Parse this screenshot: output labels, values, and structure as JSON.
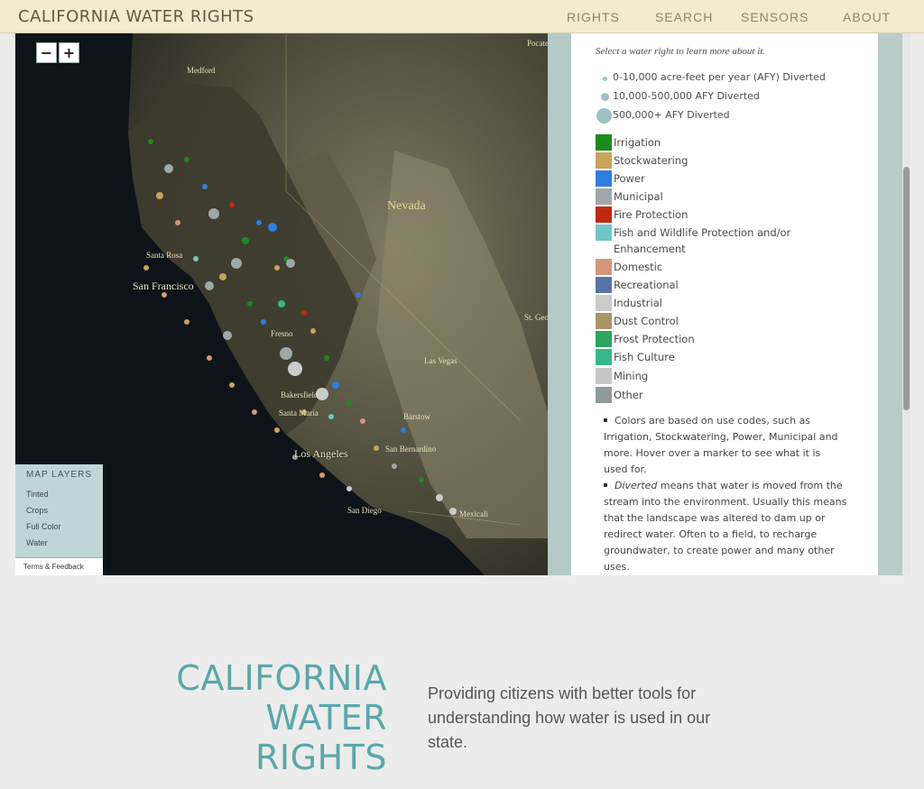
{
  "header": {
    "brand": "CALIFORNIA WATER RIGHTS",
    "nav": [
      "RIGHTS",
      "SEARCH",
      "SENSORS",
      "ABOUT"
    ]
  },
  "map": {
    "zoom_out": "−",
    "zoom_in": "+",
    "labels": {
      "pocatello": "Pocatello",
      "medford": "Medford",
      "nevada": "Nevada",
      "santa_rosa": "Santa Rosa",
      "san_francisco": "San Francisco",
      "fresno": "Fresno",
      "st_george": "St. George",
      "las_vegas": "Las Vegas",
      "bakersfield": "Bakersfield",
      "santa_maria": "Santa Maria",
      "barstow": "Barstow",
      "los_angeles": "Los Angeles",
      "san_bernardino": "San Bernardino",
      "san_diego": "San Diego",
      "mexicali": "Mexicali"
    },
    "layers": {
      "title": "MAP LAYERS",
      "options": [
        "Tinted",
        "Crops",
        "Full Color",
        "Water"
      ],
      "footer": "Terms & Feedback"
    }
  },
  "sidebar": {
    "intro": "Select a water right to learn more about it.",
    "sizes": [
      "0-10,000 acre-feet per year (AFY) Diverted",
      "10,000-500,000 AFY Diverted",
      "500,000+ AFY Diverted"
    ],
    "legend": [
      {
        "label": "Irrigation",
        "color": "#1d8a1d"
      },
      {
        "label": "Stockwatering",
        "color": "#c9a35a"
      },
      {
        "label": "Power",
        "color": "#2f7ee0"
      },
      {
        "label": "Municipal",
        "color": "#9ea7a9"
      },
      {
        "label": "Fire Protection",
        "color": "#bf2a0e"
      },
      {
        "label": "Fish and Wildlife Protection and/or Enhancement",
        "color": "#6fc6c6"
      },
      {
        "label": "Domestic",
        "color": "#d2977a"
      },
      {
        "label": "Recreational",
        "color": "#5873a8"
      },
      {
        "label": "Industrial",
        "color": "#cbcbcb"
      },
      {
        "label": "Dust Control",
        "color": "#a99467"
      },
      {
        "label": "Frost Protection",
        "color": "#2aa660"
      },
      {
        "label": "Fish Culture",
        "color": "#37b78a"
      },
      {
        "label": "Mining",
        "color": "#c6c6c6"
      },
      {
        "label": "Other",
        "color": "#8f9a9c"
      }
    ],
    "notes": {
      "colors": "Colors are based on use codes, such as Irrigation, Stockwatering, Power, Municipal and more. Hover over a marker to see what it is used for.",
      "diverted_term": "Diverted",
      "diverted_text": " means that water is moved from the stream into the environment. Usually this means that the landscape was altered to dam up or redirect water. Often to a field, to recharge groundwater, to create power and many other uses."
    }
  },
  "footer": {
    "title_lines": [
      "CALIFORNIA",
      "WATER",
      "RIGHTS"
    ],
    "tagline": "Providing citizens with better tools for understanding how water is used in our state."
  }
}
